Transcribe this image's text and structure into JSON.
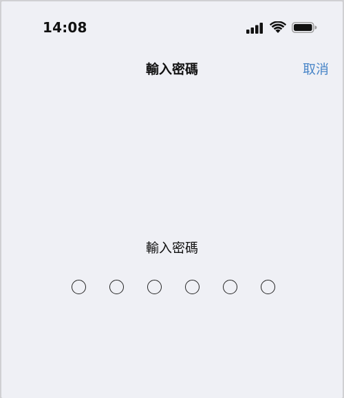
{
  "status_bar": {
    "time": "14:08",
    "icons": [
      "cellular-signal-icon",
      "wifi-icon",
      "battery-icon"
    ]
  },
  "nav": {
    "title": "輸入密碼",
    "cancel_label": "取消"
  },
  "passcode": {
    "prompt": "輸入密碼",
    "length": 6,
    "entered": 0
  },
  "colors": {
    "background": "#eff0f5",
    "accent": "#4a86c8",
    "text": "#111111"
  }
}
